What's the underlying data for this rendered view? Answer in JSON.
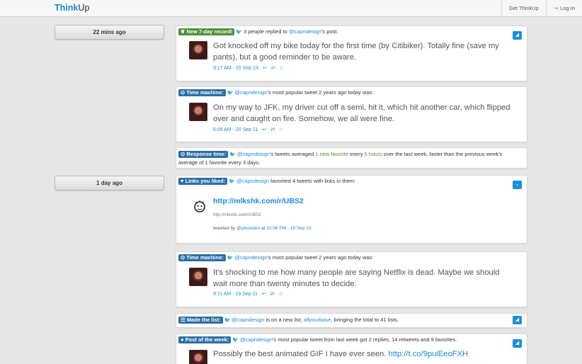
{
  "app": {
    "brand_part1": "Think",
    "brand_part2": "Up",
    "nav": [
      {
        "label": "Get ThinkUp"
      },
      {
        "label": "Log In",
        "icon": "login-icon"
      }
    ]
  },
  "dates": [
    "22 mins ago",
    "1 day ago"
  ],
  "cards": [
    {
      "badge": "New 7-day record!",
      "badge_icon": "leaf-icon",
      "head_pre": "3 people replied to ",
      "head_user": "@capndesign",
      "head_post": "'s post.",
      "tweet": "Got knocked off my bike today for the first time (by Citibiker). Totally fine (save my pants), but a good reminder to be aware.",
      "time": "9:17 AM - 20 Sep 13",
      "actions": "↩ ⇄ ☆"
    },
    {
      "badge": "Time machine:",
      "badge_icon": "clock-icon",
      "head_user": "@capndesign",
      "head_post": "'s most popular tweet 2 years ago today was:",
      "tweet": "On my way to JFK, my driver cut off a semi, hit it, which hit another car, which flipped over and caught on fire. Somehow, we all were fine.",
      "time": "6:06 AM - 20 Sep 11",
      "actions": "↩ ⇄ ☆"
    },
    {
      "badge": "Response time:",
      "badge_icon": "clock-icon",
      "user": "@capndesign",
      "t1": "'s tweets averaged ",
      "hl1": "1 new favorite",
      "t2": " every ",
      "hl2": "5 hours",
      "t3": " over the last week, faster than the previous week's average of 1 favorite every 3 days."
    },
    {
      "badge": "Links you liked:",
      "badge_icon": "heart-icon",
      "head_user": "@capndesign",
      "head_post": " favorited 4 tweets with links in them:",
      "link": "http://mlkshk.com/r/UBS2",
      "link_small": "http://mlkshk.com/r/UBS2",
      "tweeted_by_pre": "tweeted by ",
      "tweeted_by_user": "@pbowden",
      "tweeted_by_post": " at ",
      "tweeted_time": "10:36 PM - 19 Sep 13"
    },
    {
      "badge": "Time machine:",
      "badge_icon": "clock-icon",
      "head_user": "@capndesign",
      "head_post": "'s most popular tweet 2 years ago today was:",
      "tweet": "It's shocking to me how many people are saying Netflix is dead. Maybe we should wait more than twenty minutes to decide.",
      "time": "9:11 AM - 19 Sep 11",
      "actions": "↩ ⇄ ☆"
    },
    {
      "badge": "Made the list:",
      "badge_icon": "list-icon",
      "user": "@capndesign",
      "t1": " is on a new list, ",
      "list": "allyourbase",
      "t2": ", bringing the total to 41 lists."
    },
    {
      "badge": "Post of the week:",
      "badge_icon": "star-icon",
      "head_user": "@capndesign",
      "head_post": "'s most popular tweet from last week got 2 replies, 14 retweets and 9 favorites.",
      "tweet_pre": "Possibly the best animated GIF I have ever seen. ",
      "tweet_link": "http://t.co/9puiEeoFXH"
    }
  ],
  "colors": {
    "accent": "#1f8ad6",
    "green_badge": "#4f8f3b",
    "blue_badge": "#2d6fa5",
    "button": "#1a8ee0"
  }
}
